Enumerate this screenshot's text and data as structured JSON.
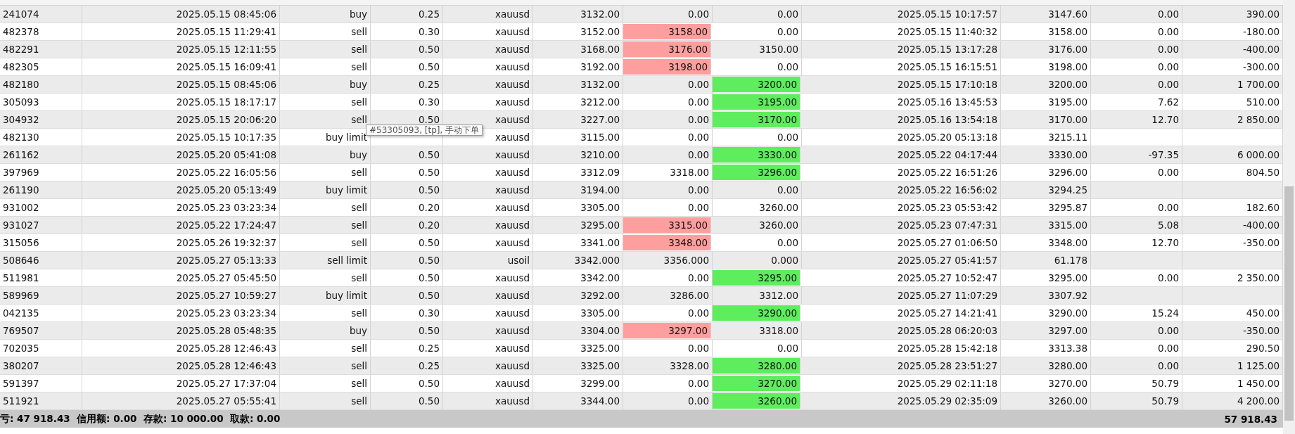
{
  "table": {
    "rows": [
      {
        "ticket": "241074",
        "open_time": "2025.05.15 08:45:06",
        "type": "buy",
        "volume": "0.25",
        "symbol": "xauusd",
        "price": "3132.00",
        "sl": "0.00",
        "sl_hit": false,
        "tp": "0.00",
        "tp_hit": false,
        "close_time": "2025.05.15 10:17:57",
        "close_price": "3147.60",
        "swap": "0.00",
        "profit": "390.00"
      },
      {
        "ticket": "482378",
        "open_time": "2025.05.15 11:29:41",
        "type": "sell",
        "volume": "0.30",
        "symbol": "xauusd",
        "price": "3152.00",
        "sl": "3158.00",
        "sl_hit": true,
        "tp": "0.00",
        "tp_hit": false,
        "close_time": "2025.05.15 11:40:32",
        "close_price": "3158.00",
        "swap": "0.00",
        "profit": "-180.00"
      },
      {
        "ticket": "482291",
        "open_time": "2025.05.15 12:11:55",
        "type": "sell",
        "volume": "0.50",
        "symbol": "xauusd",
        "price": "3168.00",
        "sl": "3176.00",
        "sl_hit": true,
        "tp": "3150.00",
        "tp_hit": false,
        "close_time": "2025.05.15 13:17:28",
        "close_price": "3176.00",
        "swap": "0.00",
        "profit": "-400.00"
      },
      {
        "ticket": "482305",
        "open_time": "2025.05.15 16:09:41",
        "type": "sell",
        "volume": "0.50",
        "symbol": "xauusd",
        "price": "3192.00",
        "sl": "3198.00",
        "sl_hit": true,
        "tp": "0.00",
        "tp_hit": false,
        "close_time": "2025.05.15 16:15:51",
        "close_price": "3198.00",
        "swap": "0.00",
        "profit": "-300.00"
      },
      {
        "ticket": "482180",
        "open_time": "2025.05.15 08:45:06",
        "type": "buy",
        "volume": "0.25",
        "symbol": "xauusd",
        "price": "3132.00",
        "sl": "0.00",
        "sl_hit": false,
        "tp": "3200.00",
        "tp_hit": true,
        "close_time": "2025.05.15 17:10:18",
        "close_price": "3200.00",
        "swap": "0.00",
        "profit": "1 700.00"
      },
      {
        "ticket": "305093",
        "open_time": "2025.05.15 18:17:17",
        "type": "sell",
        "volume": "0.30",
        "symbol": "xauusd",
        "price": "3212.00",
        "sl": "0.00",
        "sl_hit": false,
        "tp": "3195.00",
        "tp_hit": true,
        "close_time": "2025.05.16 13:45:53",
        "close_price": "3195.00",
        "swap": "7.62",
        "profit": "510.00"
      },
      {
        "ticket": "304932",
        "open_time": "2025.05.15 20:06:20",
        "type": "sell",
        "volume": "0.50",
        "symbol": "xauusd",
        "price": "3227.00",
        "sl": "0.00",
        "sl_hit": false,
        "tp": "3170.00",
        "tp_hit": true,
        "close_time": "2025.05.16 13:54:18",
        "close_price": "3170.00",
        "swap": "12.70",
        "profit": "2 850.00"
      },
      {
        "ticket": "482130",
        "open_time": "2025.05.15 10:17:35",
        "type": "buy limit",
        "symbol": "xauusd",
        "price": "3115.00",
        "sl": "0.00",
        "sl_hit": false,
        "tp": "0.00",
        "tp_hit": false,
        "close_time": "2025.05.20 05:13:18",
        "close_price": "3215.11"
      },
      {
        "ticket": "261162",
        "open_time": "2025.05.20 05:41:08",
        "type": "buy",
        "volume": "0.50",
        "symbol": "xauusd",
        "price": "3210.00",
        "sl": "0.00",
        "sl_hit": false,
        "tp": "3330.00",
        "tp_hit": true,
        "close_time": "2025.05.22 04:17:44",
        "close_price": "3330.00",
        "swap": "-97.35",
        "profit": "6 000.00"
      },
      {
        "ticket": "397969",
        "open_time": "2025.05.22 16:05:56",
        "type": "sell",
        "volume": "0.50",
        "symbol": "xauusd",
        "price": "3312.09",
        "sl": "3318.00",
        "sl_hit": false,
        "tp": "3296.00",
        "tp_hit": true,
        "close_time": "2025.05.22 16:51:26",
        "close_price": "3296.00",
        "swap": "0.00",
        "profit": "804.50"
      },
      {
        "ticket": "261190",
        "open_time": "2025.05.20 05:13:49",
        "type": "buy limit",
        "volume": "0.50",
        "symbol": "xauusd",
        "price": "3194.00",
        "sl": "0.00",
        "sl_hit": false,
        "tp": "0.00",
        "tp_hit": false,
        "close_time": "2025.05.22 16:56:02",
        "close_price": "3294.25"
      },
      {
        "ticket": "931002",
        "open_time": "2025.05.23 03:23:34",
        "type": "sell",
        "volume": "0.20",
        "symbol": "xauusd",
        "price": "3305.00",
        "sl": "0.00",
        "sl_hit": false,
        "tp": "3260.00",
        "tp_hit": false,
        "close_time": "2025.05.23 05:53:42",
        "close_price": "3295.87",
        "swap": "0.00",
        "profit": "182.60"
      },
      {
        "ticket": "931027",
        "open_time": "2025.05.22 17:24:47",
        "type": "sell",
        "volume": "0.20",
        "symbol": "xauusd",
        "price": "3295.00",
        "sl": "3315.00",
        "sl_hit": true,
        "tp": "3260.00",
        "tp_hit": false,
        "close_time": "2025.05.23 07:47:31",
        "close_price": "3315.00",
        "swap": "5.08",
        "profit": "-400.00"
      },
      {
        "ticket": "315056",
        "open_time": "2025.05.26 19:32:37",
        "type": "sell",
        "volume": "0.50",
        "symbol": "xauusd",
        "price": "3341.00",
        "sl": "3348.00",
        "sl_hit": true,
        "tp": "0.00",
        "tp_hit": false,
        "close_time": "2025.05.27 01:06:50",
        "close_price": "3348.00",
        "swap": "12.70",
        "profit": "-350.00"
      },
      {
        "ticket": "508646",
        "open_time": "2025.05.27 05:13:33",
        "type": "sell limit",
        "volume": "0.50",
        "symbol": "usoil",
        "price": "3342.000",
        "sl": "3356.000",
        "sl_hit": false,
        "tp": "0.000",
        "tp_hit": false,
        "close_time": "2025.05.27 05:41:57",
        "close_price": "61.178"
      },
      {
        "ticket": "511981",
        "open_time": "2025.05.27 05:45:50",
        "type": "sell",
        "volume": "0.50",
        "symbol": "xauusd",
        "price": "3342.00",
        "sl": "0.00",
        "sl_hit": false,
        "tp": "3295.00",
        "tp_hit": true,
        "close_time": "2025.05.27 10:52:47",
        "close_price": "3295.00",
        "swap": "0.00",
        "profit": "2 350.00"
      },
      {
        "ticket": "589969",
        "open_time": "2025.05.27 10:59:27",
        "type": "buy limit",
        "volume": "0.50",
        "symbol": "xauusd",
        "price": "3292.00",
        "sl": "3286.00",
        "sl_hit": false,
        "tp": "3312.00",
        "tp_hit": false,
        "close_time": "2025.05.27 11:07:29",
        "close_price": "3307.92"
      },
      {
        "ticket": "042135",
        "open_time": "2025.05.23 03:23:34",
        "type": "sell",
        "volume": "0.30",
        "symbol": "xauusd",
        "price": "3305.00",
        "sl": "0.00",
        "sl_hit": false,
        "tp": "3290.00",
        "tp_hit": true,
        "close_time": "2025.05.27 14:21:41",
        "close_price": "3290.00",
        "swap": "15.24",
        "profit": "450.00"
      },
      {
        "ticket": "769507",
        "open_time": "2025.05.28 05:48:35",
        "type": "buy",
        "volume": "0.50",
        "symbol": "xauusd",
        "price": "3304.00",
        "sl": "3297.00",
        "sl_hit": true,
        "tp": "3318.00",
        "tp_hit": false,
        "close_time": "2025.05.28 06:20:03",
        "close_price": "3297.00",
        "swap": "0.00",
        "profit": "-350.00"
      },
      {
        "ticket": "702035",
        "open_time": "2025.05.28 12:46:43",
        "type": "sell",
        "volume": "0.25",
        "symbol": "xauusd",
        "price": "3325.00",
        "sl": "0.00",
        "sl_hit": false,
        "tp": "0.00",
        "tp_hit": false,
        "close_time": "2025.05.28 15:42:18",
        "close_price": "3313.38",
        "swap": "0.00",
        "profit": "290.50"
      },
      {
        "ticket": "380207",
        "open_time": "2025.05.28 12:46:43",
        "type": "sell",
        "volume": "0.25",
        "symbol": "xauusd",
        "price": "3325.00",
        "sl": "3328.00",
        "sl_hit": false,
        "tp": "3280.00",
        "tp_hit": true,
        "close_time": "2025.05.28 23:51:27",
        "close_price": "3280.00",
        "swap": "0.00",
        "profit": "1 125.00"
      },
      {
        "ticket": "591397",
        "open_time": "2025.05.27 17:37:04",
        "type": "sell",
        "volume": "0.50",
        "symbol": "xauusd",
        "price": "3299.00",
        "sl": "0.00",
        "sl_hit": false,
        "tp": "3270.00",
        "tp_hit": true,
        "close_time": "2025.05.29 02:11:18",
        "close_price": "3270.00",
        "swap": "50.79",
        "profit": "1 450.00"
      },
      {
        "ticket": "511921",
        "open_time": "2025.05.27 05:55:41",
        "type": "sell",
        "volume": "0.50",
        "symbol": "xauusd",
        "price": "3344.00",
        "sl": "0.00",
        "sl_hit": false,
        "tp": "3260.00",
        "tp_hit": true,
        "close_time": "2025.05.29 02:35:09",
        "close_price": "3260.00",
        "swap": "50.79",
        "profit": "4 200.00"
      }
    ]
  },
  "tooltip": {
    "text": "#53305093, [tp], 手动下单"
  },
  "summary": {
    "text": "亏: 47 918.43  信用额: 0.00  存款: 10 000.00  取款: 0.00",
    "total": "57 918.43"
  }
}
